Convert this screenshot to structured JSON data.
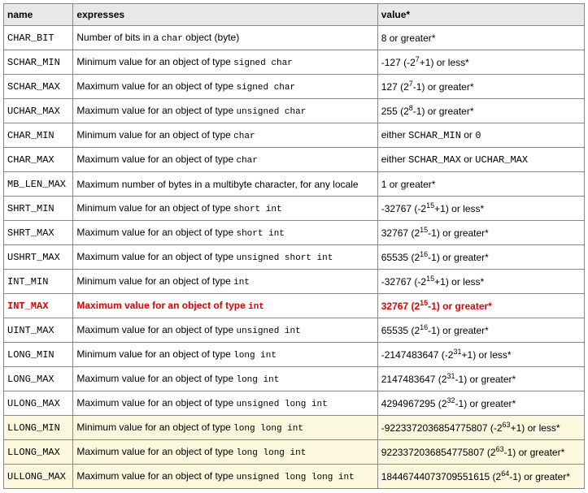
{
  "headers": {
    "name": "name",
    "expresses": "expresses",
    "value": "value*"
  },
  "rows": [
    {
      "name": "CHAR_BIT",
      "expresses_prefix": "Number of bits in a ",
      "type_code": "char",
      "expresses_suffix": " object (byte)",
      "value_text": "8 or greater*",
      "pow_base": "",
      "pow_exp": "",
      "pow_op": "",
      "pow_after": ""
    },
    {
      "name": "SCHAR_MIN",
      "expresses_prefix": "Minimum value for an object of type ",
      "type_code": "signed char",
      "expresses_suffix": "",
      "value_text": "-127 (",
      "pow_base": "-2",
      "pow_exp": "7",
      "pow_op": "+1",
      "pow_after": ") or less*"
    },
    {
      "name": "SCHAR_MAX",
      "expresses_prefix": "Maximum value for an object of type ",
      "type_code": "signed char",
      "expresses_suffix": "",
      "value_text": "127 (",
      "pow_base": "2",
      "pow_exp": "7",
      "pow_op": "-1",
      "pow_after": ") or greater*"
    },
    {
      "name": "UCHAR_MAX",
      "expresses_prefix": "Maximum value for an object of type ",
      "type_code": "unsigned char",
      "expresses_suffix": "",
      "value_text": "255 (",
      "pow_base": "2",
      "pow_exp": "8",
      "pow_op": "-1",
      "pow_after": ") or greater*"
    },
    {
      "name": "CHAR_MIN",
      "expresses_prefix": "Minimum value for an object of type ",
      "type_code": "char",
      "expresses_suffix": "",
      "value_text": "either ",
      "refs": [
        "SCHAR_MIN"
      ],
      "value_tail": " or ",
      "refs2": [
        "0"
      ],
      "value_tail2": ""
    },
    {
      "name": "CHAR_MAX",
      "expresses_prefix": "Maximum value for an object of type ",
      "type_code": "char",
      "expresses_suffix": "",
      "value_text": "either ",
      "refs": [
        "SCHAR_MAX"
      ],
      "value_tail": " or ",
      "refs2": [
        "UCHAR_MAX"
      ],
      "value_tail2": ""
    },
    {
      "name": "MB_LEN_MAX",
      "expresses_prefix": "Maximum number of bytes in a multibyte character, for any locale",
      "type_code": "",
      "expresses_suffix": "",
      "value_text": "1 or greater*",
      "pow_base": "",
      "pow_exp": "",
      "pow_op": "",
      "pow_after": ""
    },
    {
      "name": "SHRT_MIN",
      "expresses_prefix": "Minimum value for an object of type ",
      "type_code": "short int",
      "expresses_suffix": "",
      "value_text": "-32767 (",
      "pow_base": "-2",
      "pow_exp": "15",
      "pow_op": "+1",
      "pow_after": ") or less*"
    },
    {
      "name": "SHRT_MAX",
      "expresses_prefix": "Maximum value for an object of type ",
      "type_code": "short int",
      "expresses_suffix": "",
      "value_text": "32767 (",
      "pow_base": "2",
      "pow_exp": "15",
      "pow_op": "-1",
      "pow_after": ") or greater*"
    },
    {
      "name": "USHRT_MAX",
      "expresses_prefix": "Maximum value for an object of type ",
      "type_code": "unsigned short int",
      "expresses_suffix": "",
      "value_text": "65535 (",
      "pow_base": "2",
      "pow_exp": "16",
      "pow_op": "-1",
      "pow_after": ") or greater*"
    },
    {
      "name": "INT_MIN",
      "expresses_prefix": "Minimum value for an object of type ",
      "type_code": "int",
      "expresses_suffix": "",
      "value_text": "-32767 (",
      "pow_base": "-2",
      "pow_exp": "15",
      "pow_op": "+1",
      "pow_after": ") or less*"
    },
    {
      "name": "INT_MAX",
      "expresses_prefix": "Maximum value for an object of type ",
      "type_code": "int",
      "expresses_suffix": "",
      "value_text": "32767 (",
      "pow_base": "2",
      "pow_exp": "15",
      "pow_op": "-1",
      "pow_after": ") or greater*",
      "highlighted": true
    },
    {
      "name": "UINT_MAX",
      "expresses_prefix": "Maximum value for an object of type ",
      "type_code": "unsigned int",
      "expresses_suffix": "",
      "value_text": "65535 (",
      "pow_base": "2",
      "pow_exp": "16",
      "pow_op": "-1",
      "pow_after": ") or greater*"
    },
    {
      "name": "LONG_MIN",
      "expresses_prefix": "Minimum value for an object of type ",
      "type_code": "long int",
      "expresses_suffix": "",
      "value_text": "-2147483647 (",
      "pow_base": "-2",
      "pow_exp": "31",
      "pow_op": "+1",
      "pow_after": ") or less*"
    },
    {
      "name": "LONG_MAX",
      "expresses_prefix": "Maximum value for an object of type ",
      "type_code": "long int",
      "expresses_suffix": "",
      "value_text": "2147483647 (",
      "pow_base": "2",
      "pow_exp": "31",
      "pow_op": "-1",
      "pow_after": ") or greater*"
    },
    {
      "name": "ULONG_MAX",
      "expresses_prefix": "Maximum value for an object of type ",
      "type_code": "unsigned long int",
      "expresses_suffix": "",
      "value_text": "4294967295 (",
      "pow_base": "2",
      "pow_exp": "32",
      "pow_op": "-1",
      "pow_after": ") or greater*"
    },
    {
      "name": "LLONG_MIN",
      "expresses_prefix": "Minimum value for an object of type ",
      "type_code": "long long int",
      "expresses_suffix": "",
      "value_text": "-9223372036854775807 (",
      "pow_base": "-2",
      "pow_exp": "63",
      "pow_op": "+1",
      "pow_after": ") or less*",
      "cpp11": true
    },
    {
      "name": "LLONG_MAX",
      "expresses_prefix": "Maximum value for an object of type ",
      "type_code": "long long int",
      "expresses_suffix": "",
      "value_text": "9223372036854775807 (",
      "pow_base": "2",
      "pow_exp": "63",
      "pow_op": "-1",
      "pow_after": ") or greater*",
      "cpp11": true
    },
    {
      "name": "ULLONG_MAX",
      "expresses_prefix": "Maximum value for an object of type ",
      "type_code": "unsigned long long int",
      "expresses_suffix": "",
      "value_text": "18446744073709551615 (",
      "pow_base": "2",
      "pow_exp": "64",
      "pow_op": "-1",
      "pow_after": ") or greater*",
      "cpp11": true
    }
  ]
}
